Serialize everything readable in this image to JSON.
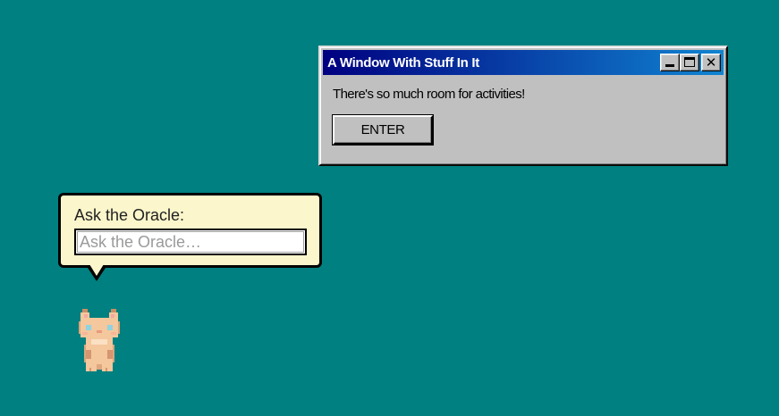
{
  "window": {
    "title": "A Window With Stuff In It",
    "controls": {
      "minimize_icon": "minimize-icon",
      "maximize_icon": "maximize-icon",
      "close_icon": "close-icon"
    },
    "body_text": "There's so much room for activities!",
    "enter_label": "ENTER"
  },
  "oracle": {
    "label": "Ask the Oracle:",
    "input_value": "",
    "input_placeholder": "Ask the Oracle…"
  },
  "mascot": {
    "icon": "pixel-cat-icon"
  },
  "colors": {
    "desktop": "#008080",
    "title_bar_start": "#000080",
    "title_bar_end": "#1084d0",
    "window_face": "#c0c0c0",
    "bubble": "#fbf6cb",
    "cat_fur": "#f4c79d",
    "cat_eye": "#8fd3e0"
  }
}
